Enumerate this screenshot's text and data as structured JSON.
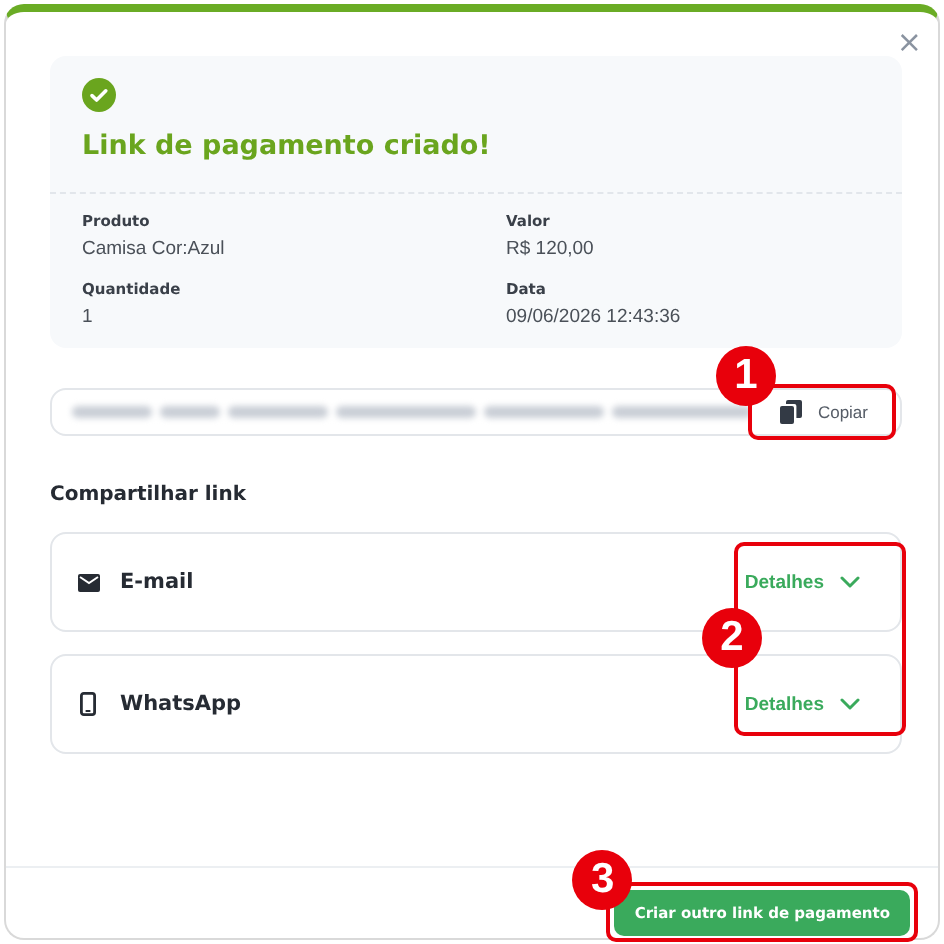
{
  "dialog": {
    "close": "×"
  },
  "summary": {
    "title": "Link de pagamento criado!",
    "fields": [
      {
        "label": "Produto",
        "value": "Camisa Cor:Azul"
      },
      {
        "label": "Valor",
        "value": "R$ 120,00"
      },
      {
        "label": "Quantidade",
        "value": "1"
      },
      {
        "label": "Data",
        "value": "09/06/2026 12:43:36"
      }
    ]
  },
  "link": {
    "copy_button": "Copiar",
    "annotation": "1"
  },
  "share": {
    "heading": "Compartilhar link",
    "items": [
      {
        "kind": "email",
        "label": "E-mail",
        "action": "Detalhes",
        "expanded": false
      },
      {
        "kind": "phone",
        "label": "WhatsApp",
        "action": "Detalhes",
        "expanded": false
      }
    ],
    "annotation": "2"
  },
  "footer": {
    "button": "Criar outro link de pagamento",
    "annotation": "3"
  }
}
